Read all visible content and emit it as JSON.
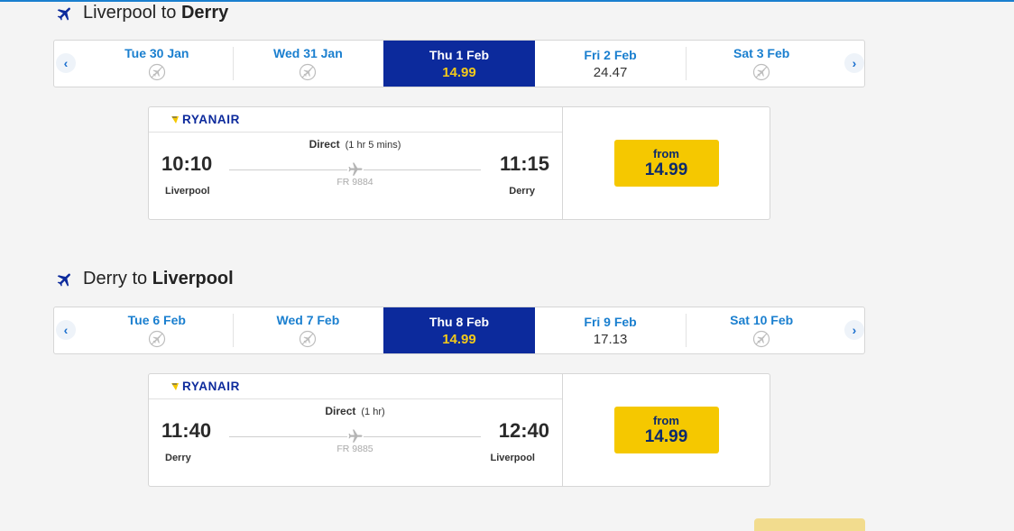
{
  "outbound": {
    "origin": "Liverpool to ",
    "destination": "Derry",
    "dates": [
      {
        "label": "Tue 30 Jan",
        "price": null
      },
      {
        "label": "Wed 31 Jan",
        "price": null
      },
      {
        "label": "Thu 1 Feb",
        "price": "14.99",
        "selected": true
      },
      {
        "label": "Fri 2 Feb",
        "price": "24.47"
      },
      {
        "label": "Sat 3 Feb",
        "price": null
      }
    ],
    "flight": {
      "airline": "RYANAIR",
      "departure_time": "10:10",
      "arrival_time": "11:15",
      "departure_city": "Liverpool",
      "arrival_city": "Derry",
      "route_type": "Direct",
      "duration": "(1 hr 5 mins)",
      "flight_number": "FR 9884",
      "price_prefix": "from",
      "price": "14.99"
    }
  },
  "return": {
    "origin": "Derry to ",
    "destination": "Liverpool",
    "dates": [
      {
        "label": "Tue 6 Feb",
        "price": null
      },
      {
        "label": "Wed 7 Feb",
        "price": null
      },
      {
        "label": "Thu 8 Feb",
        "price": "14.99",
        "selected": true
      },
      {
        "label": "Fri 9 Feb",
        "price": "17.13"
      },
      {
        "label": "Sat 10 Feb",
        "price": null
      }
    ],
    "flight": {
      "airline": "RYANAIR",
      "departure_time": "11:40",
      "arrival_time": "12:40",
      "departure_city": "Derry",
      "arrival_city": "Liverpool",
      "route_type": "Direct",
      "duration": "(1 hr)",
      "flight_number": "FR 9885",
      "price_prefix": "from",
      "price": "14.99"
    }
  },
  "icons": {
    "plane": "plane-icon",
    "no_flights": "no-flights-icon",
    "prev": "chevron-left-icon",
    "next": "chevron-right-icon",
    "airline_logo": "ryanair-harp-icon"
  },
  "colors": {
    "brand_blue": "#0c2a9c",
    "link_blue": "#1a7fcf",
    "accent_yellow": "#f5c800"
  }
}
